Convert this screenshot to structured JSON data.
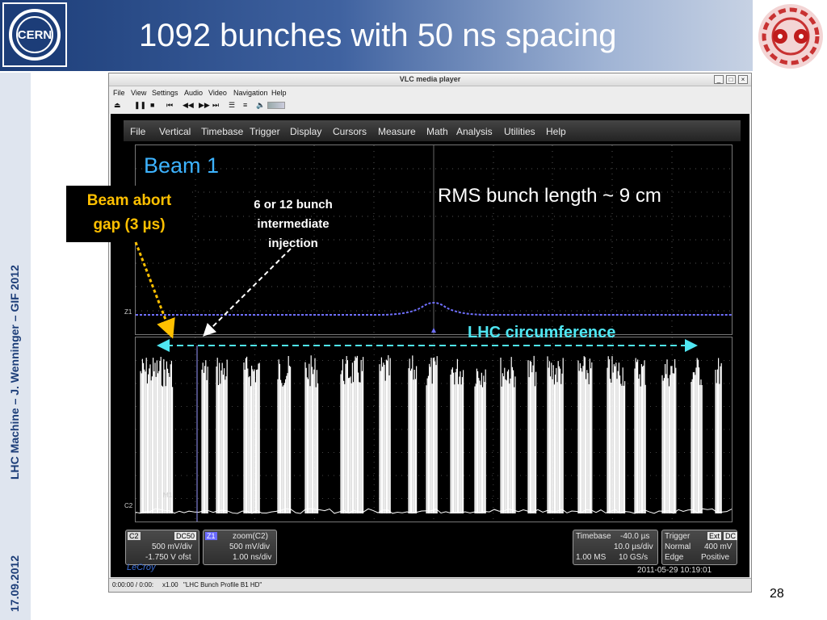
{
  "slide": {
    "title": "1092 bunches with 50 ns spacing",
    "footer_left": "LHC Machine  –  J. Wenninger – GIF 2012",
    "date": "17.09.2012",
    "page_number": "28",
    "logo_text": "CERN"
  },
  "vlc": {
    "window_title": "VLC media player",
    "menu": [
      "File",
      "View",
      "Settings",
      "Audio",
      "Video",
      "Navigation",
      "Help"
    ],
    "win_buttons": [
      "_",
      "□",
      "×"
    ],
    "controls": [
      "⏏",
      "❚❚",
      "■",
      "⏮",
      "◀◀",
      "▶▶",
      "⏭",
      "☰",
      "≡",
      "🔈"
    ],
    "status": {
      "time": "0:00:00 / 0:00:",
      "speed": "x1.00",
      "file": "\"LHC Bunch Profile B1 HD\""
    }
  },
  "scope": {
    "menu": [
      "File",
      "Vertical",
      "Timebase",
      "Trigger",
      "Display",
      "Cursors",
      "Measure",
      "Math",
      "Analysis",
      "Utilities",
      "Help"
    ],
    "trace_label_top": "Z1",
    "trace_label_bottom": "C2",
    "marker_label": "M1",
    "c2": {
      "name": "C2",
      "coupling": "DC50",
      "scale": "500 mV/div",
      "offset": "-1.750 V ofst"
    },
    "z1": {
      "name": "Z1",
      "source": "zoom(C2)",
      "scale": "500 mV/div",
      "timebase": "1.00 ns/div"
    },
    "timebase": {
      "label": "Timebase",
      "value": "-40.0 µs",
      "div": "10.0 µs/div",
      "points": "1.00 MS",
      "rate": "10 GS/s"
    },
    "trigger": {
      "label": "Trigger",
      "source": "Ext",
      "coupling": "DC",
      "mode": "Normal",
      "level": "400 mV",
      "type": "Edge",
      "slope": "Positive"
    },
    "brand": "LeCroy",
    "datetime": "2011-05-29 10:19:01"
  },
  "annotations": {
    "beam": "Beam 1",
    "abort_gap_line1": "Beam abort",
    "abort_gap_line2": "gap (3 µs)",
    "injection_line1": "6 or 12 bunch",
    "injection_line2": "intermediate",
    "injection_line3": "injection",
    "rms": "RMS bunch length ~ 9 cm",
    "circumference": "LHC circumference"
  },
  "colors": {
    "header_dark": "#1c3d78",
    "beam_label": "#3db3ff",
    "abort_text": "#ffc000",
    "circumference": "#4fe6f2",
    "trace": "#7070ff"
  }
}
